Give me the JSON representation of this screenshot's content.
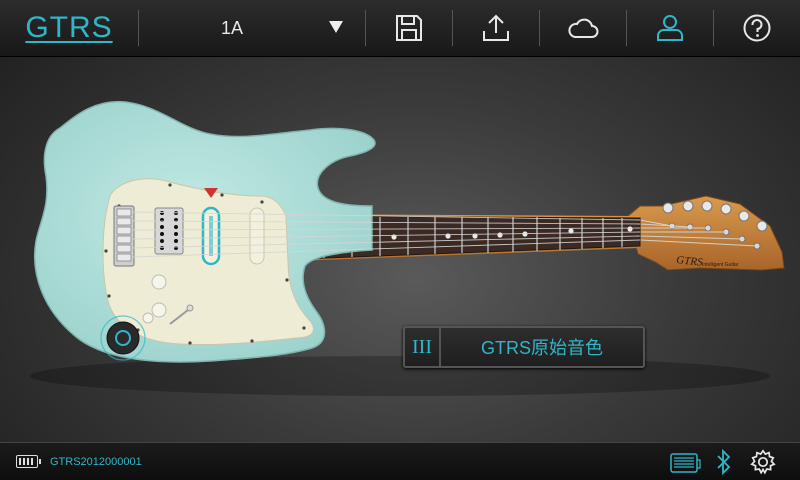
{
  "app": {
    "logo": "GTRS"
  },
  "toolbar": {
    "preset": "1A",
    "buttons": [
      "save",
      "export",
      "cloud",
      "account",
      "help"
    ]
  },
  "tone": {
    "index": "III",
    "name": "GTRS原始音色"
  },
  "status": {
    "device_id": "GTRS2012000001",
    "battery_level": 1.0
  },
  "colors": {
    "accent": "#2fb6c9",
    "body": "#b6e2dd",
    "pickguard": "#eeecd4",
    "fretboard": "#3b2a24",
    "neck": "#c8873e"
  },
  "icons": {
    "save": "save-icon",
    "export": "upload-icon",
    "cloud": "cloud-icon",
    "account": "user-icon",
    "help": "help-icon",
    "dropdown": "chevron-down-icon",
    "connection": "amp-icon",
    "bluetooth": "bluetooth-icon",
    "settings": "gear-icon"
  }
}
